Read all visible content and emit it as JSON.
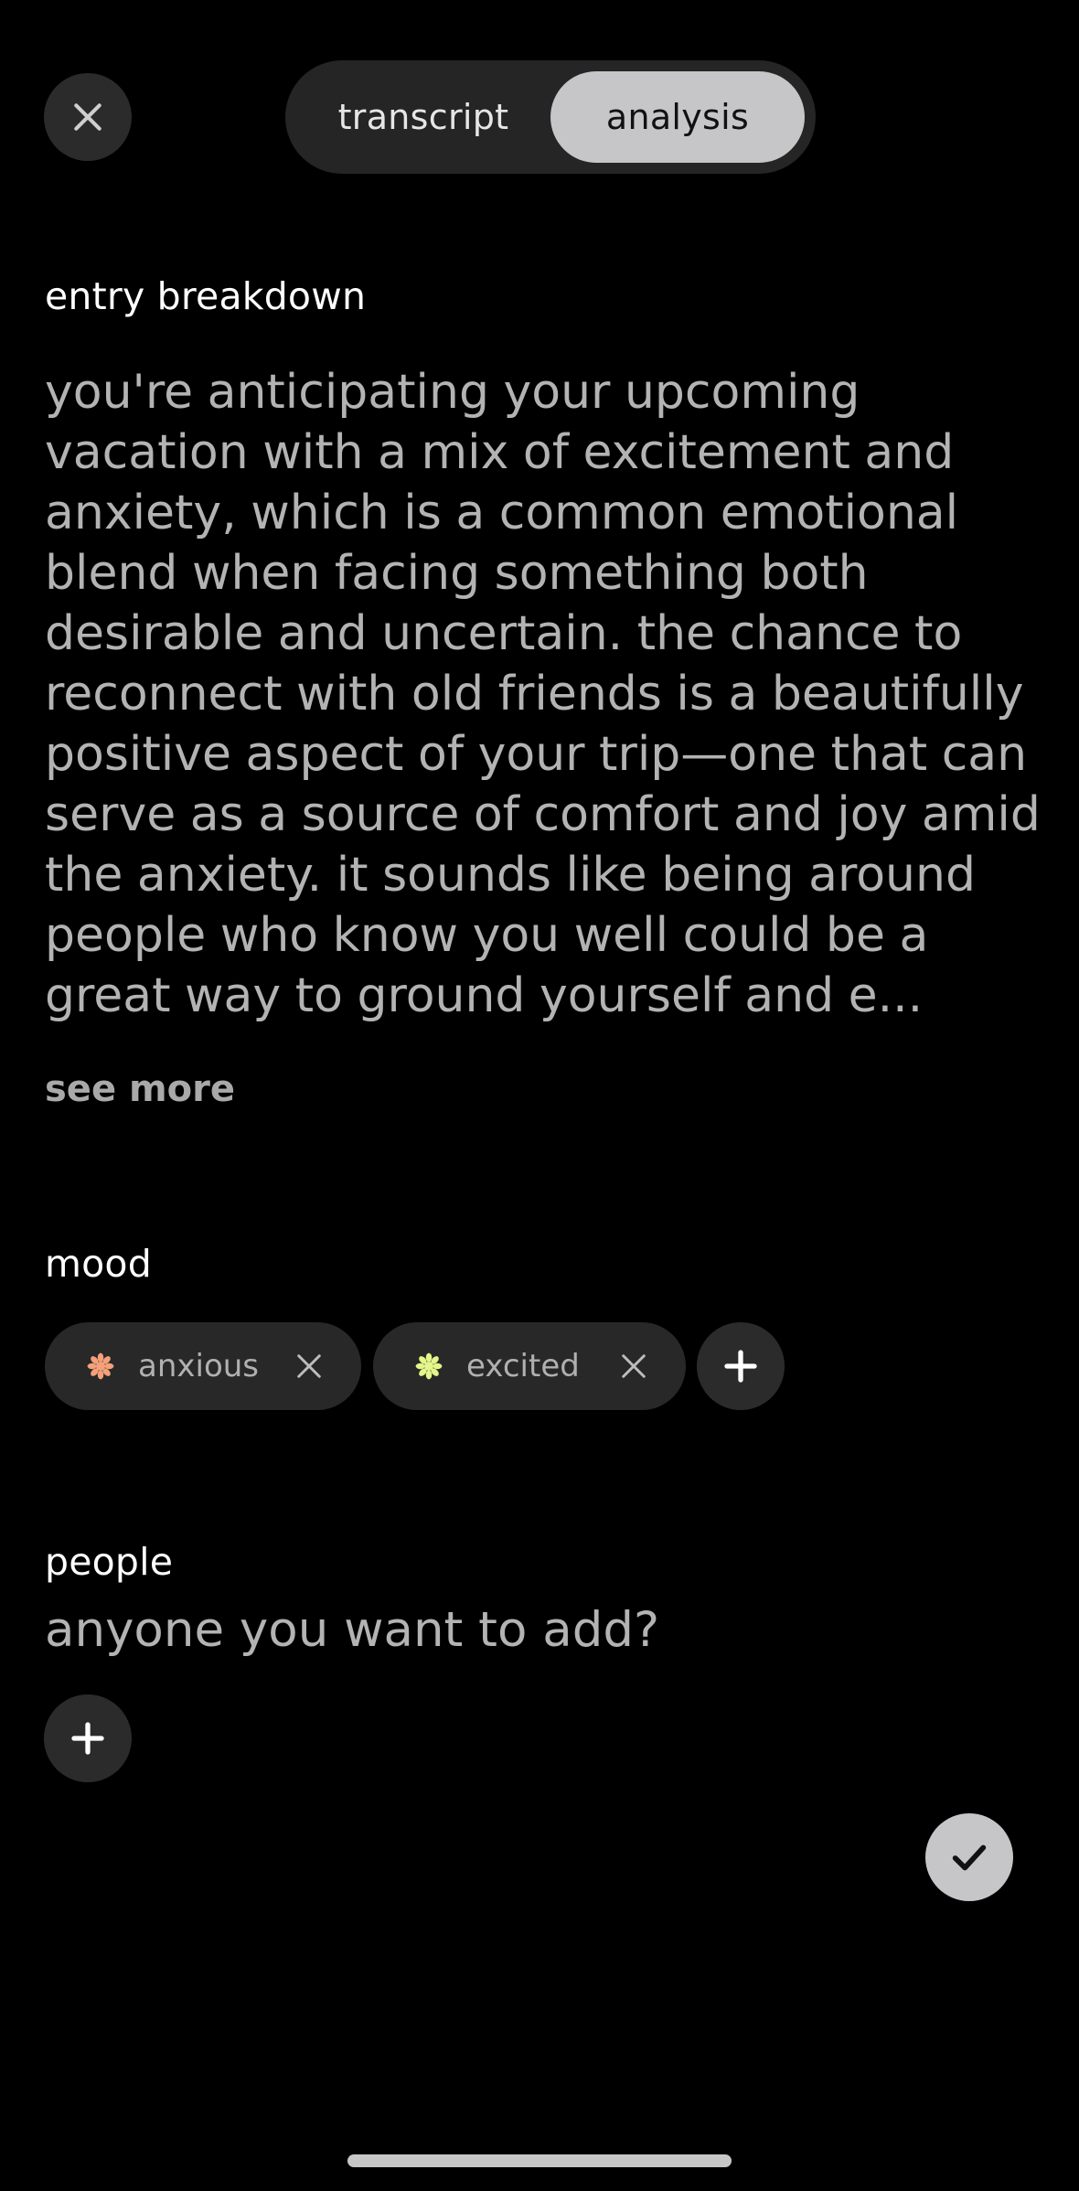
{
  "header": {
    "close_icon": "close-icon",
    "tabs": [
      {
        "label": "transcript",
        "active": false
      },
      {
        "label": "analysis",
        "active": true
      }
    ]
  },
  "breakdown": {
    "label": "entry breakdown",
    "text": "you're anticipating your upcoming vacation with a mix of excitement and anxiety, which is a common emotional blend when facing something both desirable and uncertain. the chance to reconnect with old friends is a beautifully positive aspect of your trip—one that can serve as a source of comfort and joy amid the anxiety. it sounds like being around people who know you well could be a great way to ground yourself and e...",
    "see_more": "see more"
  },
  "mood": {
    "label": "mood",
    "chips": [
      {
        "label": "anxious",
        "icon": "flower-icon",
        "color": "#f4a07a"
      },
      {
        "label": "excited",
        "icon": "flower-icon",
        "color": "#e4f58a"
      }
    ],
    "add_icon": "plus-icon"
  },
  "people": {
    "label": "people",
    "prompt": "anyone you want to add?",
    "add_icon": "plus-icon"
  },
  "confirm_icon": "checkmark-icon",
  "colors": {
    "background": "#000000",
    "surface": "#2b2b2b",
    "active_tab": "#c6c6c8",
    "body_text": "#b3b3b3"
  }
}
